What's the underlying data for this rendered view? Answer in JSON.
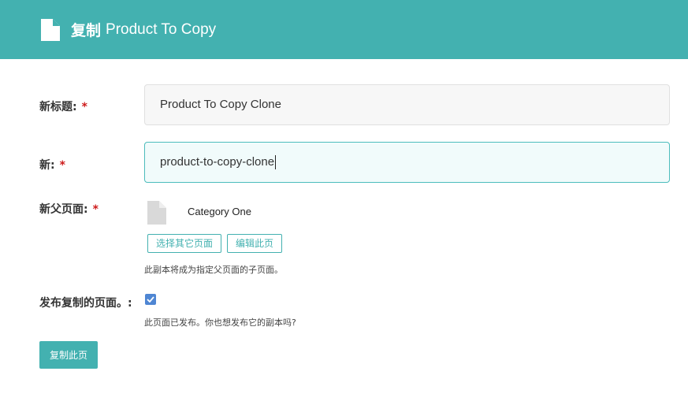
{
  "header": {
    "action": "复制",
    "page_title": "Product To Copy"
  },
  "form": {
    "new_title": {
      "label": "新标题:",
      "required_mark": "*",
      "value": "Product To Copy Clone"
    },
    "new_slug": {
      "label": "新:",
      "required_mark": "*",
      "value": "product-to-copy-clone"
    },
    "new_parent": {
      "label": "新父页面:",
      "required_mark": "*",
      "page_name": "Category One",
      "choose_button": "选择其它页面",
      "edit_button": "编辑此页",
      "help": "此副本将成为指定父页面的子页面。"
    },
    "publish": {
      "label": "发布复制的页面。:",
      "checked": true,
      "help": "此页面已发布。你也想发布它的副本吗?"
    },
    "submit_label": "复制此页"
  },
  "colors": {
    "accent": "#43b1b0",
    "required": "#cd1a1a",
    "checkbox": "#4f86d3"
  }
}
